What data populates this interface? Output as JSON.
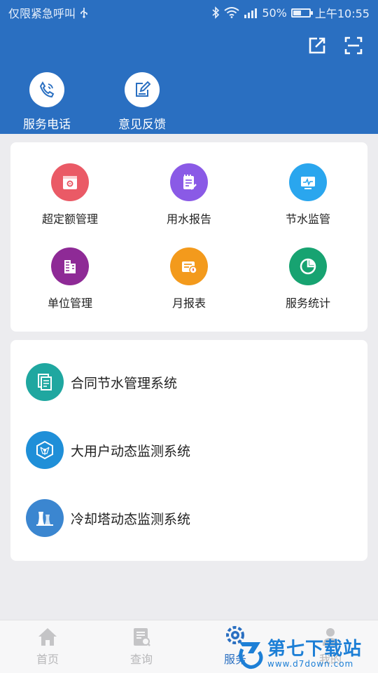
{
  "status_bar": {
    "carrier": "仅限紧急呼叫",
    "battery": "50%",
    "battery_level": 0.5,
    "time": "上午10:55"
  },
  "header": {
    "actions": [
      {
        "icon": "share-icon"
      },
      {
        "icon": "scan-icon"
      }
    ],
    "quick_links": [
      {
        "label": "服务电话",
        "icon": "phone-icon"
      },
      {
        "label": "意见反馈",
        "icon": "feedback-icon"
      }
    ]
  },
  "grid": {
    "items": [
      {
        "label": "超定额管理",
        "icon": "calendar-gear-icon",
        "color": "#ea5a66"
      },
      {
        "label": "用水报告",
        "icon": "notepad-icon",
        "color": "#8a5ae6"
      },
      {
        "label": "节水监管",
        "icon": "monitor-icon",
        "color": "#2aa6ee"
      },
      {
        "label": "单位管理",
        "icon": "building-icon",
        "color": "#8e2a96"
      },
      {
        "label": "月报表",
        "icon": "report-icon",
        "color": "#f39a1c"
      },
      {
        "label": "服务统计",
        "icon": "pie-chart-icon",
        "color": "#17a371"
      }
    ]
  },
  "systems": {
    "items": [
      {
        "label": "合同节水管理系统",
        "icon": "documents-icon",
        "color": "#1fa7a0"
      },
      {
        "label": "大用户动态监测系统",
        "icon": "network-icon",
        "color": "#1f8fd8"
      },
      {
        "label": "冷却塔动态监测系统",
        "icon": "cooling-tower-icon",
        "color": "#3b86d0"
      }
    ]
  },
  "bottom_nav": {
    "items": [
      {
        "label": "首页",
        "icon": "home-icon",
        "active": false
      },
      {
        "label": "查询",
        "icon": "query-icon",
        "active": false
      },
      {
        "label": "服务",
        "icon": "service-icon",
        "active": true
      },
      {
        "label": "我的",
        "icon": "user-icon",
        "active": false
      }
    ]
  },
  "watermark": {
    "title": "第七下载站",
    "url": "www.d7down.com"
  },
  "colors": {
    "header_bg": "#2a6fc1",
    "page_bg": "#ececef",
    "active_nav": "#2a6fc1",
    "inactive_nav": "#b7b7b9"
  }
}
